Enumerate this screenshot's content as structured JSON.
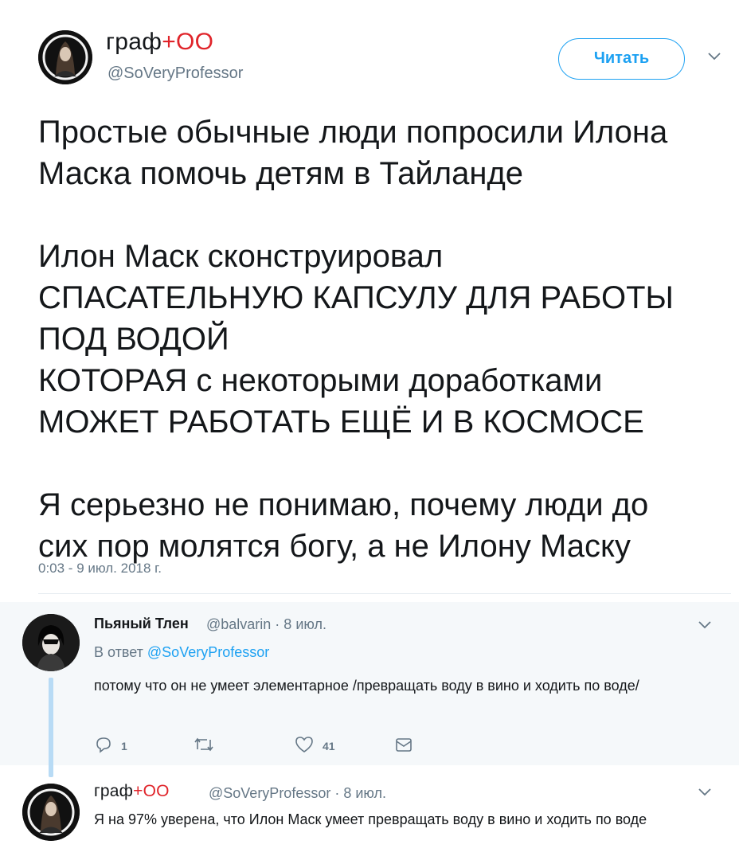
{
  "main_tweet": {
    "display_name_prefix": "граф",
    "display_name_cross": "+",
    "display_name_suffix": "OO",
    "handle": "@SoVeryProfessor",
    "follow_label": "Читать",
    "paragraphs": [
      [
        "Простые обычные люди попросили Илона",
        "Маска помочь детям в Тайланде"
      ],
      [
        "Илон Маск сконструировал",
        "СПАСАТЕЛЬНУЮ КАПСУЛУ ДЛЯ РАБОТЫ",
        "ПОД ВОДОЙ",
        "КОТОРАЯ с некоторыми доработками",
        "МОЖЕТ РАБОТАТЬ ЕЩЁ И В КОСМОСЕ"
      ],
      [
        "Я серьезно не понимаю, почему люди до",
        "сих пор молятся богу, а не Илону Маску"
      ]
    ],
    "timestamp": "0:03 - 9 июл. 2018 г."
  },
  "reply_1": {
    "display_name": "Пьяный Тлен",
    "meta": "@balvarin · 8 июл.",
    "reply_to_prefix": "В ответ",
    "reply_to_mention": "@SoVeryProfessor",
    "text": "потому что он не умеет элементарное /превращать воду в вино и ходить по воде/",
    "actions": {
      "reply_count": "1",
      "retweet_count": "",
      "like_count": "41"
    }
  },
  "reply_2": {
    "display_name_prefix": "граф",
    "display_name_cross": "+",
    "display_name_suffix": "OO",
    "meta": "@SoVeryProfessor · 8 июл.",
    "text": "Я на 97% уверена, что Илон Маск умеет превращать воду в вино и ходить по воде"
  },
  "colors": {
    "accent": "#1da1f2",
    "secondary_text": "#657786",
    "primary_text": "#14171a",
    "highlight_bg": "#f5f8fa",
    "thread_line": "#b8dbf5",
    "name_emoji_red": "#e0242a"
  },
  "icons": [
    "chevron-down-icon",
    "reply-icon",
    "retweet-icon",
    "like-icon",
    "direct-message-icon"
  ]
}
